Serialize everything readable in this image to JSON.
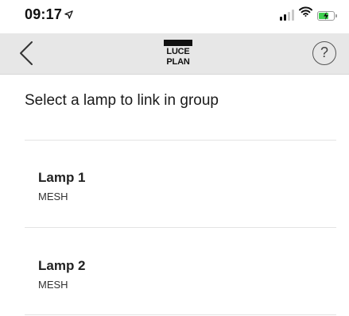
{
  "status_bar": {
    "time": "09:17",
    "location_icon": "location-arrow-icon",
    "signal_icon": "cellular-signal-icon",
    "wifi_icon": "wifi-icon",
    "battery_icon": "battery-charging-icon"
  },
  "nav": {
    "back_icon": "chevron-left-icon",
    "logo_line1": "LUCE",
    "logo_line2": "PLAN",
    "help_label": "?"
  },
  "page": {
    "title": "Select a lamp to link in group"
  },
  "lamps": [
    {
      "name": "Lamp 1",
      "type": "MESH"
    },
    {
      "name": "Lamp 2",
      "type": "MESH"
    }
  ],
  "colors": {
    "nav_background": "#e7e7e7",
    "battery_fill": "#3fcf4f"
  }
}
